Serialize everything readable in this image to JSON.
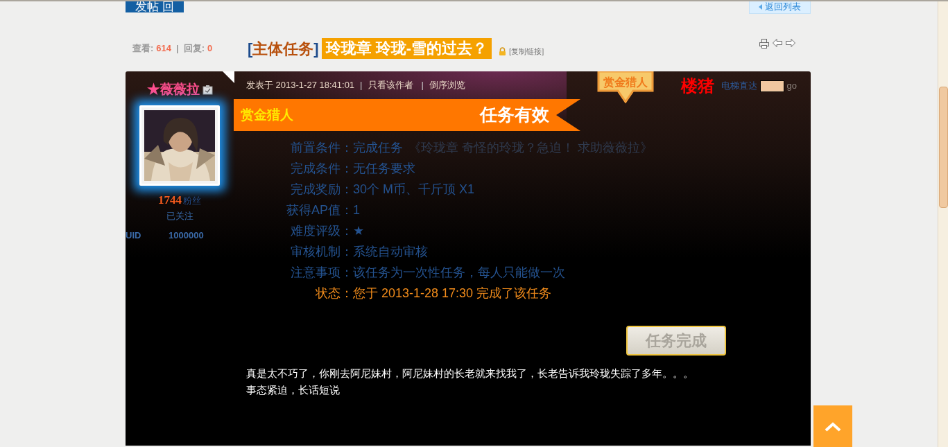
{
  "post_button": {
    "label": "发帖 回"
  },
  "back_link": {
    "label": "返回列表"
  },
  "stats": {
    "views_label": "查看:",
    "views": "614",
    "separator": "|",
    "replies_label": "回复:",
    "replies": "0"
  },
  "thread_title": {
    "open_bracket": "[",
    "category": "主体任务",
    "close_bracket": "]",
    "title": "玲珑章 玲珑-雪的过去？",
    "copy_link": "[复制链接]"
  },
  "author": {
    "name": "★薇薇拉",
    "fans_count": "1744",
    "fans_label": "粉丝",
    "follow": "已关注",
    "uid_label": "UID",
    "uid": "1000000"
  },
  "post_meta": {
    "posted": "发表于 2013-1-27 18:41:01",
    "separator_1": "|",
    "only_author": "只看该作者",
    "separator_2": "|",
    "reverse": "倒序浏览"
  },
  "badge": "赏金猎人",
  "floor_label": "楼猪",
  "jump": {
    "label": "电梯直达",
    "go": "go"
  },
  "task_banner": {
    "left": "赏金猎人",
    "right": "任务有效"
  },
  "task_fields": [
    {
      "kind": "info",
      "label": "前置条件：",
      "value": "完成任务",
      "link": "《玲珑章 奇怪的玲珑？急迫！ 求助薇薇拉》"
    },
    {
      "kind": "info",
      "label": "完成条件：",
      "value": "无任务要求"
    },
    {
      "kind": "info",
      "label": "完成奖励：",
      "value": "30个 M币、千斤顶 X1"
    },
    {
      "kind": "info",
      "label": "获得AP值：",
      "value": "1"
    },
    {
      "kind": "info",
      "label": "难度评级：",
      "value": "★"
    },
    {
      "kind": "info",
      "label": "审核机制：",
      "value": "系统自动审核"
    },
    {
      "kind": "info",
      "label": "注意事项：",
      "value": "该任务为一次性任务，每人只能做一次"
    },
    {
      "kind": "status",
      "label": "状态：",
      "value": "您于 2013-1-28 17:30 完成了该任务"
    }
  ],
  "complete_button": {
    "label": "任务完成",
    "disabled": true
  },
  "post_body": [
    "真是太不巧了，你刚去阿尼妹村，阿尼妹村的长老就来找我了，长老告诉我玲珑失踪了多年。。。",
    "事态紧迫，长话短说"
  ]
}
